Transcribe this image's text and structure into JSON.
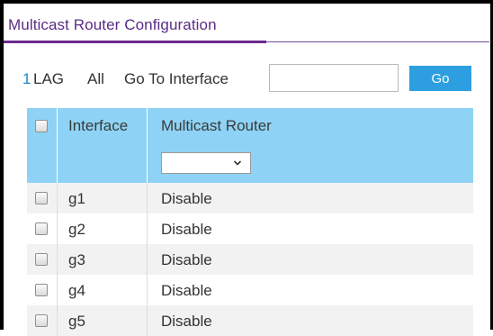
{
  "panel": {
    "title": "Multicast Router Configuration"
  },
  "toolbar": {
    "one": "1",
    "lag": "LAG",
    "all": "All",
    "goto_label": "Go To Interface",
    "goto_value": "",
    "go_label": "Go"
  },
  "table": {
    "headers": {
      "interface": "Interface",
      "multicast_router": "Multicast Router"
    },
    "filter": {
      "selected": ""
    },
    "rows": [
      {
        "interface": "g1",
        "multicast_router": "Disable"
      },
      {
        "interface": "g2",
        "multicast_router": "Disable"
      },
      {
        "interface": "g3",
        "multicast_router": "Disable"
      },
      {
        "interface": "g4",
        "multicast_router": "Disable"
      },
      {
        "interface": "g5",
        "multicast_router": "Disable"
      }
    ]
  },
  "icons": {
    "dropdown": "chevron-down-icon"
  },
  "colors": {
    "title": "#5b2c86",
    "accent_line": "#6b2a8f",
    "link": "#1f86c8",
    "go_button": "#2d9fe0",
    "table_header": "#8ed3f5",
    "row_alt": "#f2f2f2"
  }
}
